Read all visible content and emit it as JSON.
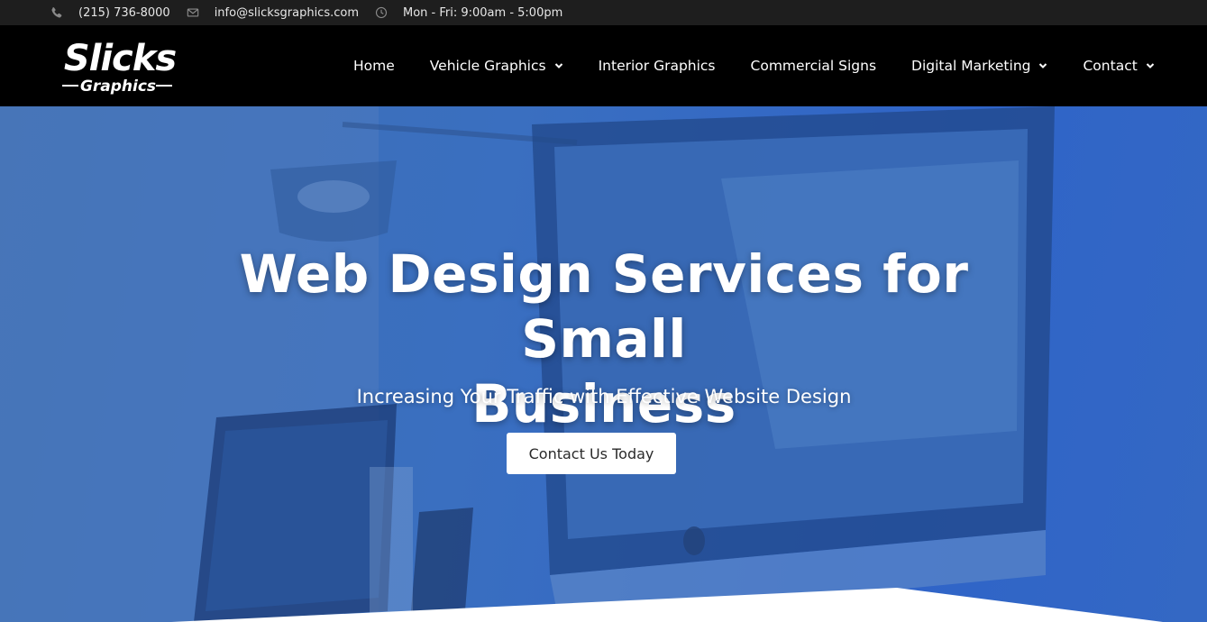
{
  "topbar": {
    "phone": "(215) 736-8000",
    "email": "info@slicksgraphics.com",
    "hours": "Mon - Fri: 9:00am - 5:00pm",
    "icons": [
      "phone-icon",
      "envelope-icon",
      "clock-icon"
    ]
  },
  "logo": {
    "line1": "Slicks",
    "line2": "Graphics"
  },
  "nav": {
    "items": [
      {
        "label": "Home",
        "has_dropdown": false
      },
      {
        "label": "Vehicle Graphics",
        "has_dropdown": true
      },
      {
        "label": "Interior Graphics",
        "has_dropdown": false
      },
      {
        "label": "Commercial Signs",
        "has_dropdown": false
      },
      {
        "label": "Digital Marketing",
        "has_dropdown": true
      },
      {
        "label": "Contact",
        "has_dropdown": true
      }
    ]
  },
  "hero": {
    "title_line1": "Web Design Services for Small",
    "title_line2": "Business",
    "subtitle": "Increasing Your Traffic with Effective Website Design",
    "cta_label": "Contact Us Today"
  },
  "colors": {
    "topbar_bg": "#1e1e1e",
    "header_bg": "#000000",
    "hero_overlay": "#3a6fc0",
    "cta_bg": "#ffffff"
  }
}
